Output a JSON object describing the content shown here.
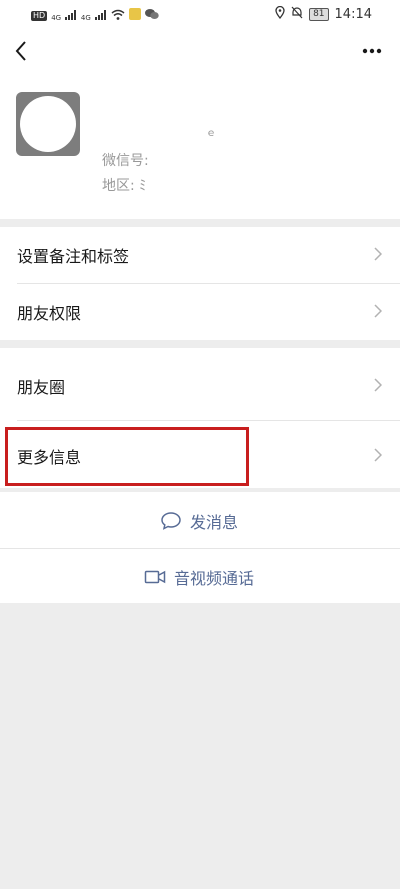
{
  "status_bar": {
    "hd_badge": "HD",
    "signal_1": "4G",
    "signal_2": "4G",
    "battery": "81",
    "time": "14:14"
  },
  "topbar": {
    "back_icon": "back-chevron-icon",
    "more_icon": "more-dots-icon"
  },
  "profile": {
    "nickname_fragment": "ｅ",
    "wechat_id_label": "微信号:",
    "region_label": "地区: ",
    "region_value": "ﾐ"
  },
  "menu_group_1": [
    {
      "label": "设置备注和标签"
    },
    {
      "label": "朋友权限"
    }
  ],
  "menu_group_2": [
    {
      "label": "朋友圈"
    },
    {
      "label": "更多信息"
    }
  ],
  "actions": {
    "send_message": "发消息",
    "video_call": "音视频通话"
  },
  "colors": {
    "link_blue": "#576b95",
    "highlight_red": "#c81e1e",
    "background_gray": "#ededed"
  }
}
